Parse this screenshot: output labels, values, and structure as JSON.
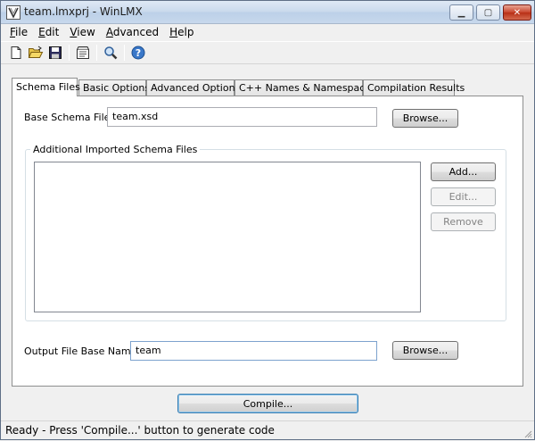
{
  "window": {
    "title": "team.lmxprj - WinLMX",
    "min_glyph": "▁",
    "max_glyph": "▢",
    "close_glyph": "✕"
  },
  "menu": {
    "items": [
      {
        "accel": "F",
        "rest": "ile"
      },
      {
        "accel": "E",
        "rest": "dit"
      },
      {
        "accel": "V",
        "rest": "iew"
      },
      {
        "accel": "A",
        "rest": "dvanced"
      },
      {
        "accel": "H",
        "rest": "elp"
      }
    ]
  },
  "toolbar": {
    "icons": [
      "new-file-icon",
      "open-folder-icon",
      "save-icon",
      "compile-icon",
      "find-icon",
      "help-icon"
    ]
  },
  "tabs": [
    {
      "label": "Schema Files",
      "active": true
    },
    {
      "label": "Basic Options",
      "active": false
    },
    {
      "label": "Advanced Options",
      "active": false
    },
    {
      "label": "C++ Names & Namespaces",
      "active": false
    },
    {
      "label": "Compilation Results",
      "active": false
    }
  ],
  "schema": {
    "base_label": "Base Schema File:",
    "base_value": "team.xsd",
    "browse_label": "Browse...",
    "group_title": "Additional Imported Schema Files",
    "add_label": "Add...",
    "edit_label": "Edit...",
    "remove_label": "Remove",
    "output_label": "Output File Base Name:",
    "output_value": "team",
    "browse2_label": "Browse..."
  },
  "compile_label": "Compile...",
  "status": "Ready - Press 'Compile...' button to generate code",
  "colors": {
    "help_icon": "#3a78c9",
    "title_bar": "#c9d9ec",
    "close_button": "#c8442c"
  }
}
